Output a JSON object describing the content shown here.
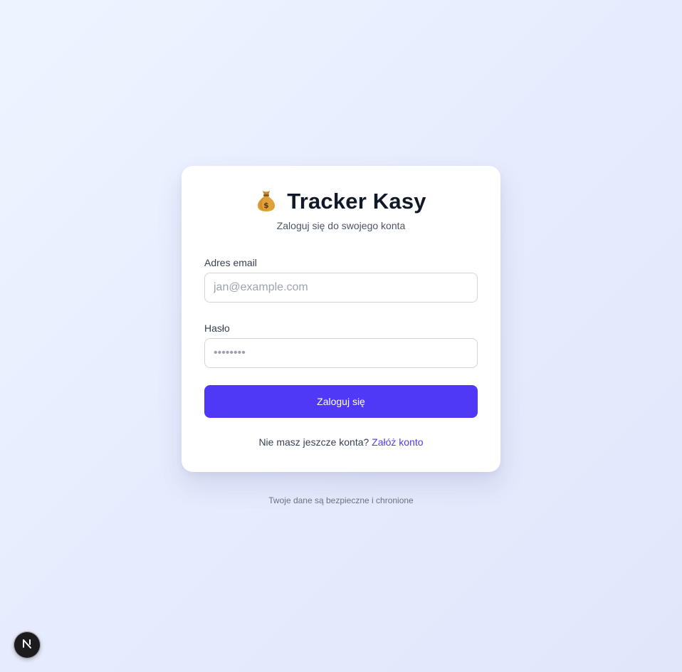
{
  "header": {
    "icon": "money-bag-icon",
    "title": "Tracker Kasy",
    "subtitle": "Zaloguj się do swojego konta"
  },
  "form": {
    "email_label": "Adres email",
    "email_placeholder": "jan@example.com",
    "password_label": "Hasło",
    "password_placeholder": "••••••••",
    "submit_label": "Zaloguj się"
  },
  "signup": {
    "prompt": "Nie masz jeszcze konta?",
    "link_label": "Załóż konto"
  },
  "footer": {
    "note": "Twoje dane są bezpieczne i chronione"
  },
  "dev_badge": {
    "icon": "nextjs-logo-icon"
  },
  "colors": {
    "accent": "#4f39f6",
    "card": "#ffffff",
    "title": "#111827"
  }
}
